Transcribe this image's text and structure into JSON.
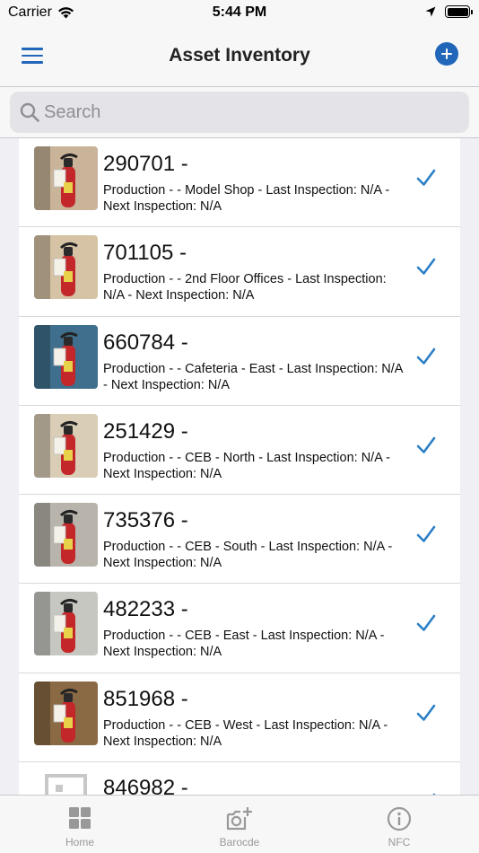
{
  "status": {
    "carrier": "Carrier",
    "time": "5:44 PM"
  },
  "nav": {
    "title": "Asset Inventory"
  },
  "search": {
    "placeholder": "Search",
    "value": ""
  },
  "assets": [
    {
      "id": "290701 -",
      "details": "Production -  - Model Shop - Last Inspection: N/A - Next Inspection: N/A",
      "photo": "extinguisher-photo",
      "checked": true
    },
    {
      "id": "701105 -",
      "details": "Production -  - 2nd Floor Offices - Last Inspection: N/A - Next Inspection: N/A",
      "photo": "extinguisher-photo",
      "checked": true
    },
    {
      "id": "660784 -",
      "details": "Production -  - Cafeteria - East - Last Inspection: N/A - Next Inspection: N/A",
      "photo": "extinguisher-photo",
      "checked": true
    },
    {
      "id": "251429 -",
      "details": "Production -  - CEB - North - Last Inspection: N/A - Next Inspection: N/A",
      "photo": "extinguisher-photo",
      "checked": true
    },
    {
      "id": "735376 -",
      "details": "Production -  - CEB - South - Last Inspection: N/A - Next Inspection: N/A",
      "photo": "extinguisher-photo",
      "checked": true
    },
    {
      "id": "482233 -",
      "details": "Production -  - CEB - East - Last Inspection: N/A - Next Inspection: N/A",
      "photo": "extinguisher-photo",
      "checked": true
    },
    {
      "id": "851968 -",
      "details": "Production -  - CEB - West - Last Inspection: N/A - Next Inspection: N/A",
      "photo": "extinguisher-photo",
      "checked": true
    },
    {
      "id": "846982 -",
      "details": "",
      "photo": "placeholder-image",
      "checked": true
    }
  ],
  "tabs": [
    {
      "label": "Home",
      "icon": "grid-icon"
    },
    {
      "label": "Barocde",
      "icon": "camera-add-icon"
    },
    {
      "label": "NFC",
      "icon": "info-icon"
    }
  ],
  "colors": {
    "accent": "#2166b8",
    "check": "#2b7fc6",
    "tab_inactive": "#999999"
  }
}
